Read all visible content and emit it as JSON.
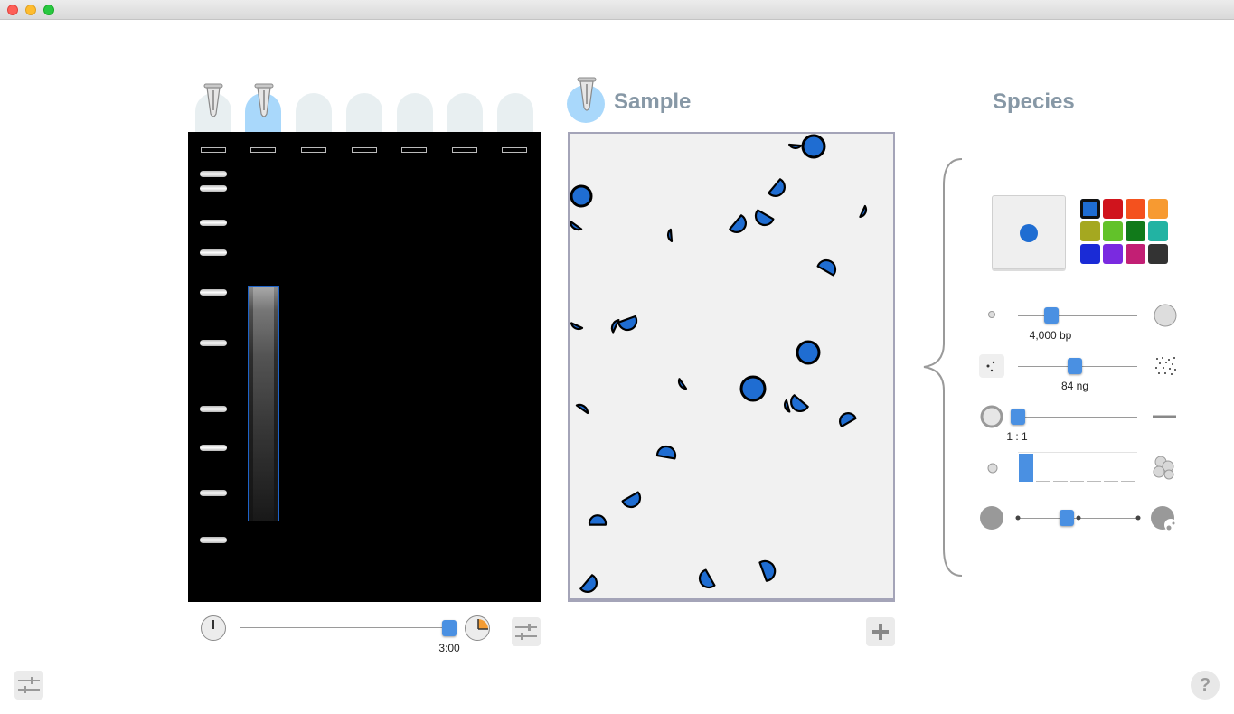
{
  "window": {
    "title": ""
  },
  "lanes": {
    "count": 7,
    "active_index": 1,
    "loaded": [
      0,
      1
    ]
  },
  "gel": {
    "ladder_bands": 10,
    "smear_lane": 1
  },
  "timer": {
    "label": "3:00",
    "progress": 1.0
  },
  "sample": {
    "title": "Sample"
  },
  "species": {
    "title": "Species",
    "selected_color": "#1f6dd2",
    "palette": [
      "#1f6dd2",
      "#d0141d",
      "#f4511e",
      "#f79a31",
      "#a5a820",
      "#62c22a",
      "#117a1a",
      "#22b3a3",
      "#1a2bd6",
      "#7a2ae0",
      "#c21f74",
      "#333333"
    ],
    "size": {
      "label": "4,000 bp",
      "fraction": 0.17
    },
    "amount": {
      "label": "84 ng",
      "fraction": 0.47
    },
    "ratio": {
      "label": "1 : 1",
      "fraction": 0.0
    },
    "shape_bar": {
      "filled_steps": 1,
      "total_steps": 7
    },
    "shape_slider": {
      "fraction": 0.41
    }
  },
  "icons": {
    "settings": "sliders-icon",
    "add": "plus-icon",
    "help": "question-icon"
  },
  "help_label": "?"
}
